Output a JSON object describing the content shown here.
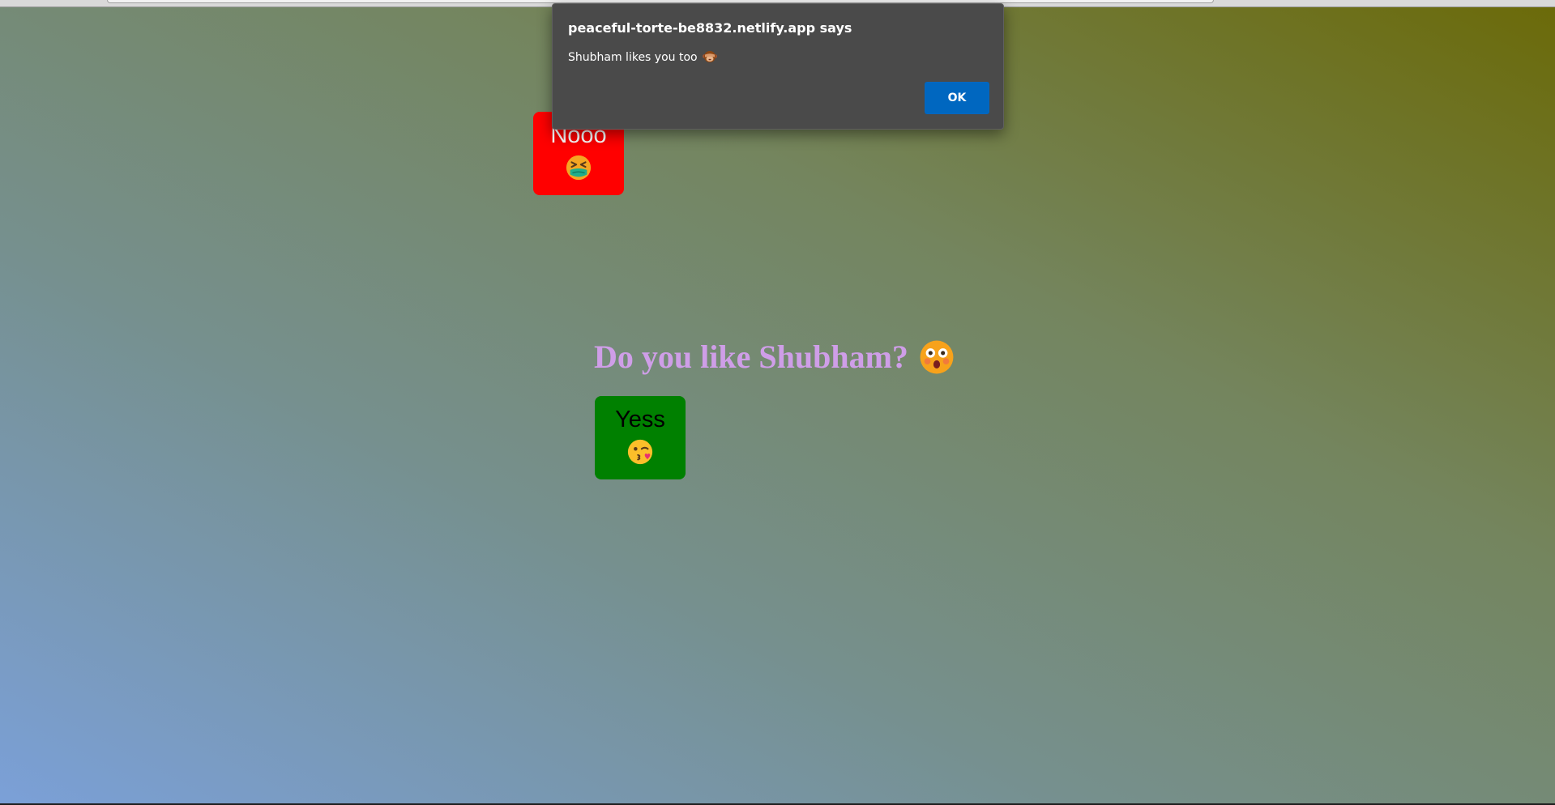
{
  "alert": {
    "title": "peaceful-torte-be8832.netlify.app says",
    "message": "Shubham likes you too",
    "message_icon": "see-no-evil-monkey-icon",
    "ok_label": "OK",
    "ok_color": "#0067c0"
  },
  "page": {
    "question": "Do you like Shubham?",
    "question_icon": "astonished-face-icon",
    "question_color": "#cf9ee8"
  },
  "buttons": {
    "no": {
      "label": "Nooo",
      "icon": "nauseated-face-icon",
      "color": "#ff0000"
    },
    "yes": {
      "label": "Yess",
      "icon": "kissing-wink-face-icon",
      "color": "#008000"
    }
  }
}
